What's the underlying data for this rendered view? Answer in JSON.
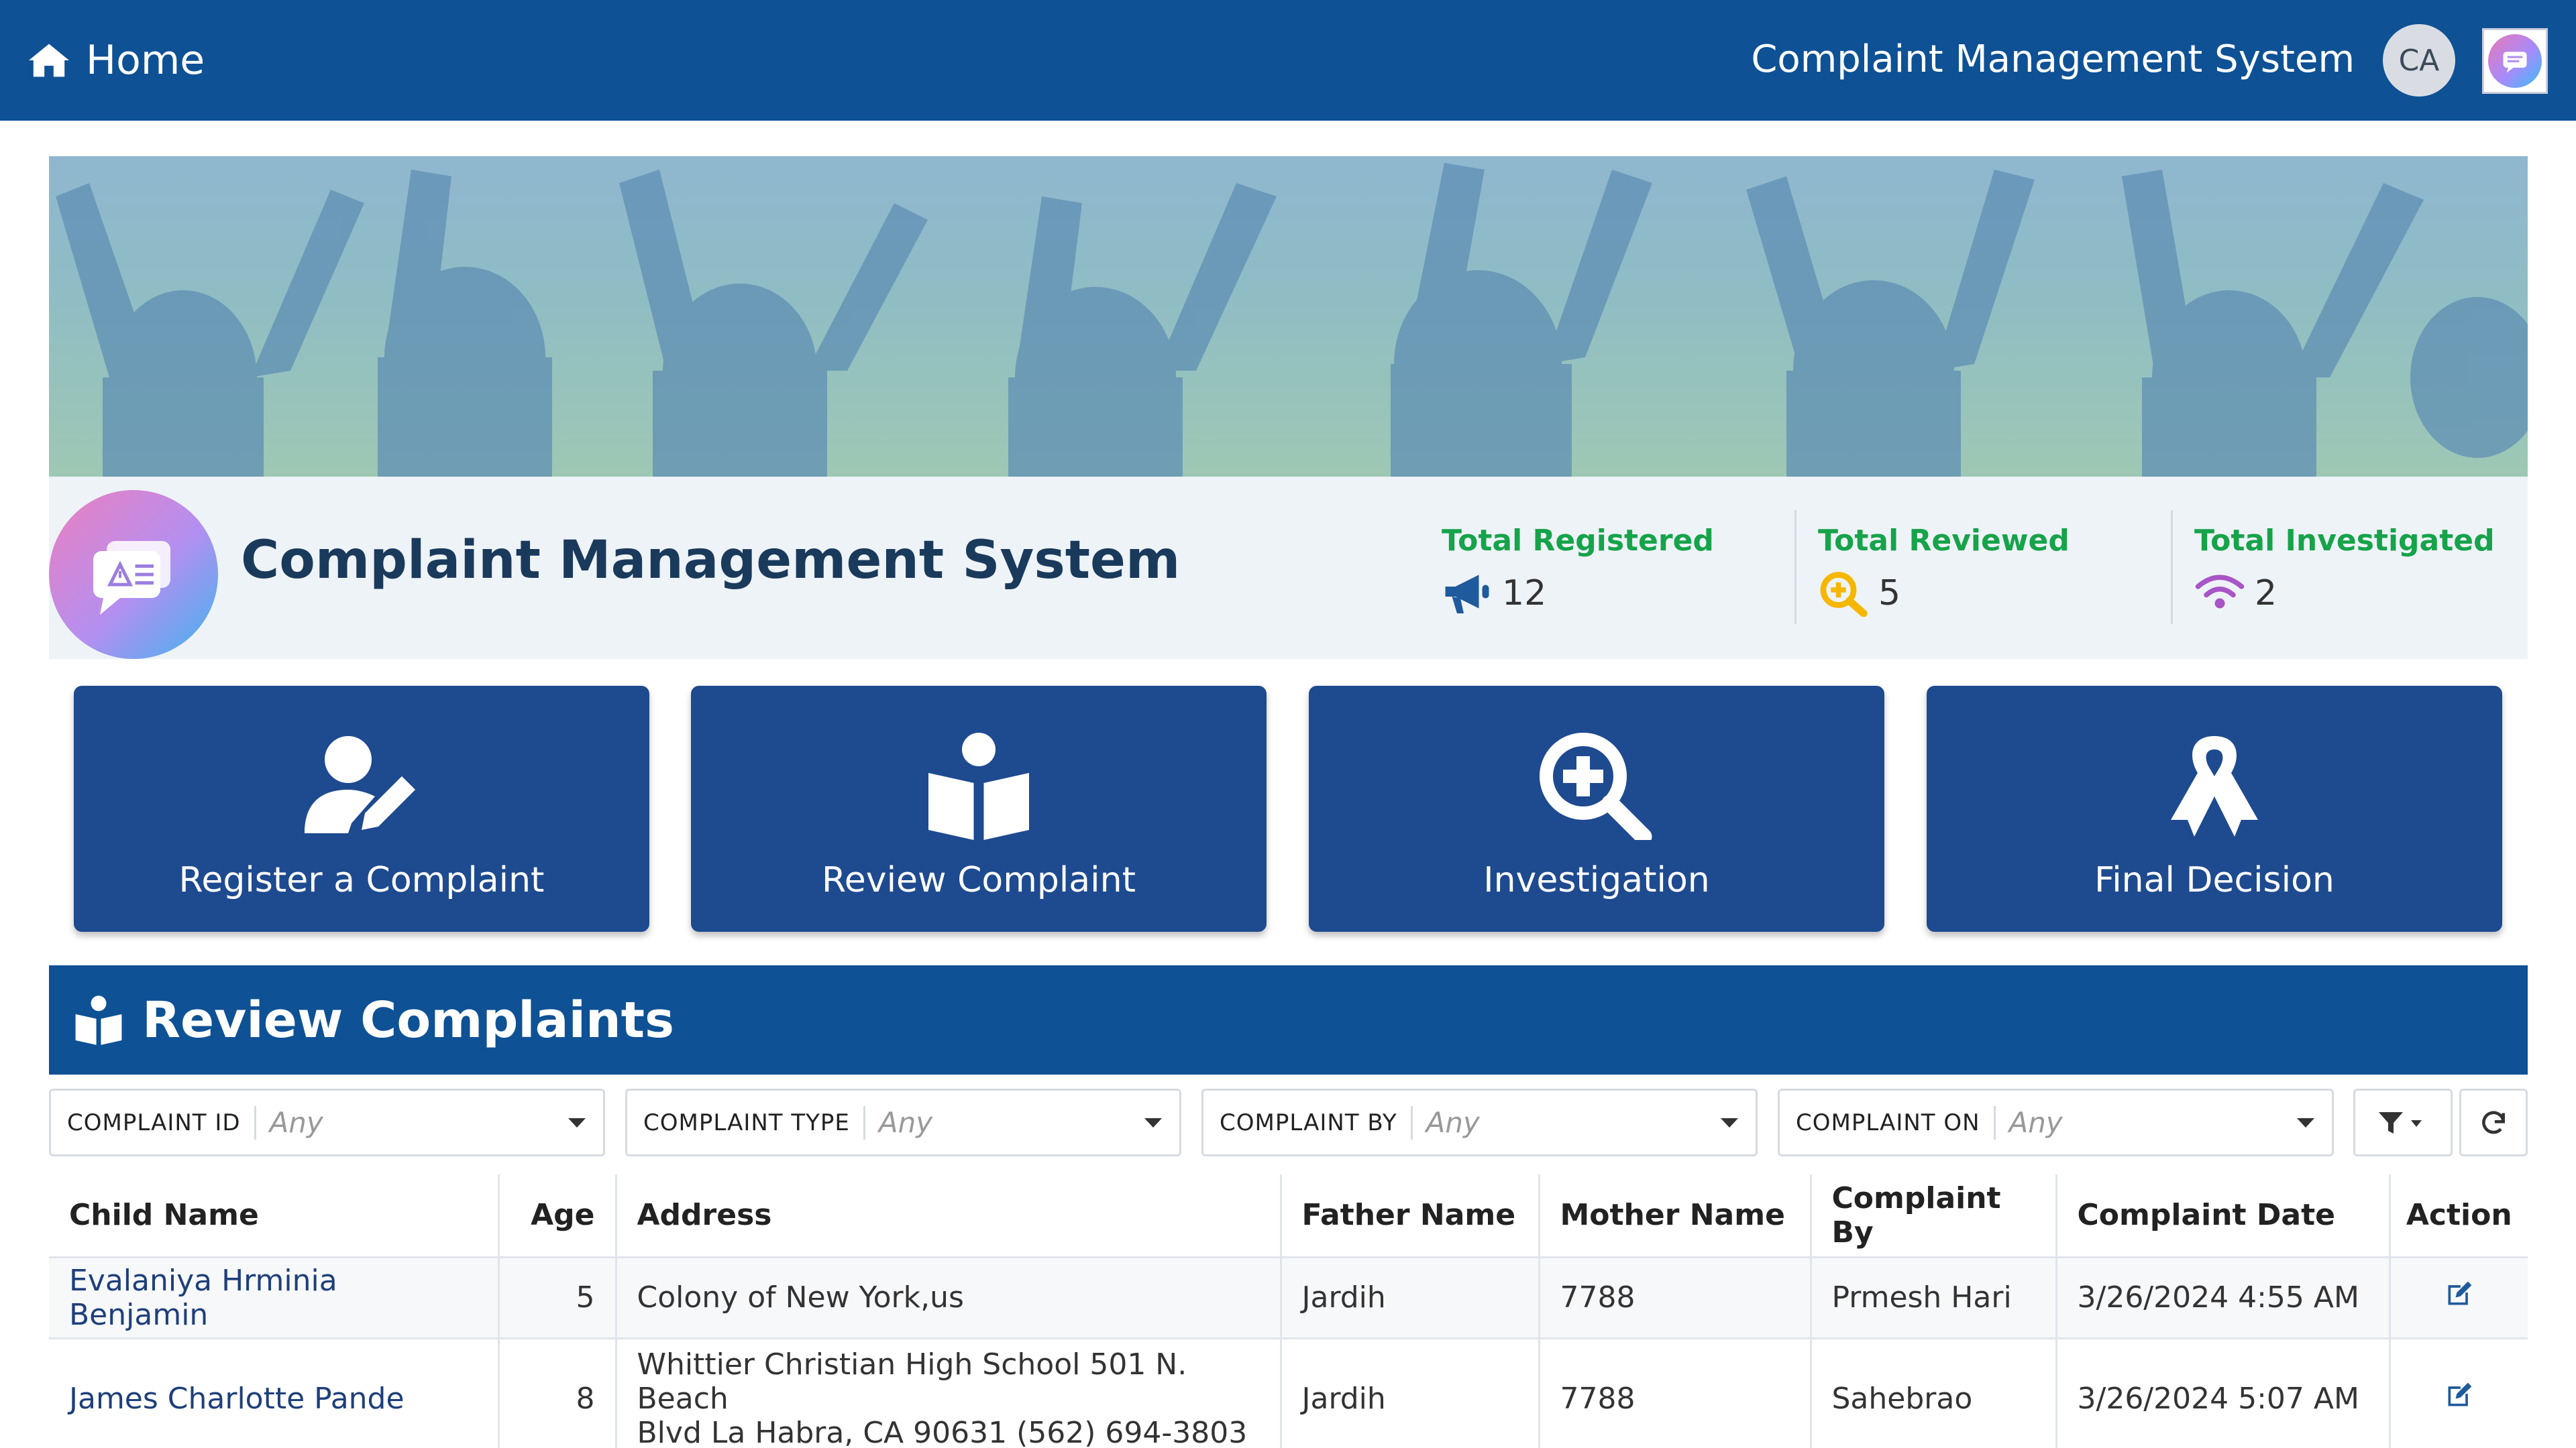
{
  "nav": {
    "home_label": "Home",
    "app_title": "Complaint Management System",
    "avatar_initials": "CA"
  },
  "info": {
    "title": "Complaint Management System",
    "stats": [
      {
        "label": "Total Registered",
        "value": "12",
        "icon": "megaphone-icon"
      },
      {
        "label": "Total Reviewed",
        "value": "5",
        "icon": "magnify-plus-icon"
      },
      {
        "label": "Total Investigated",
        "value": "2",
        "icon": "signal-icon"
      }
    ]
  },
  "actions": [
    {
      "label": "Register a Complaint",
      "icon": "user-edit-icon"
    },
    {
      "label": "Review Complaint",
      "icon": "reader-icon"
    },
    {
      "label": "Investigation",
      "icon": "search-plus-icon"
    },
    {
      "label": "Final Decision",
      "icon": "ribbon-icon"
    }
  ],
  "review": {
    "title": "Review Complaints",
    "filters": [
      {
        "label": "COMPLAINT ID",
        "placeholder": "Any"
      },
      {
        "label": "COMPLAINT TYPE",
        "placeholder": "Any"
      },
      {
        "label": "COMPLAINT BY",
        "placeholder": "Any"
      },
      {
        "label": "COMPLAINT ON",
        "placeholder": "Any"
      }
    ],
    "columns": [
      "Child Name",
      "Age",
      "Address",
      "Father Name",
      "Mother Name",
      "Complaint By",
      "Complaint Date",
      "Action"
    ],
    "rows": [
      {
        "child": "Evalaniya Hrminia Benjamin",
        "age": "5",
        "address": "Colony of New York,us",
        "father": "Jardih",
        "mother": "7788",
        "by": "Prmesh Hari",
        "date": "3/26/2024 4:55 AM"
      },
      {
        "child": "James Charlotte Pande",
        "age": "8",
        "address_line1": "Whittier Christian High School 501 N. Beach",
        "address_line2": "Blvd La Habra, CA 90631 (562) 694-3803",
        "father": "Jardih",
        "mother": "7788",
        "by": "Sahebrao",
        "date": "3/26/2024 5:07 AM"
      }
    ]
  },
  "colors": {
    "nav_blue": "#0e5195",
    "button_blue": "#1e4a8f",
    "stat_green": "#16a34a"
  }
}
